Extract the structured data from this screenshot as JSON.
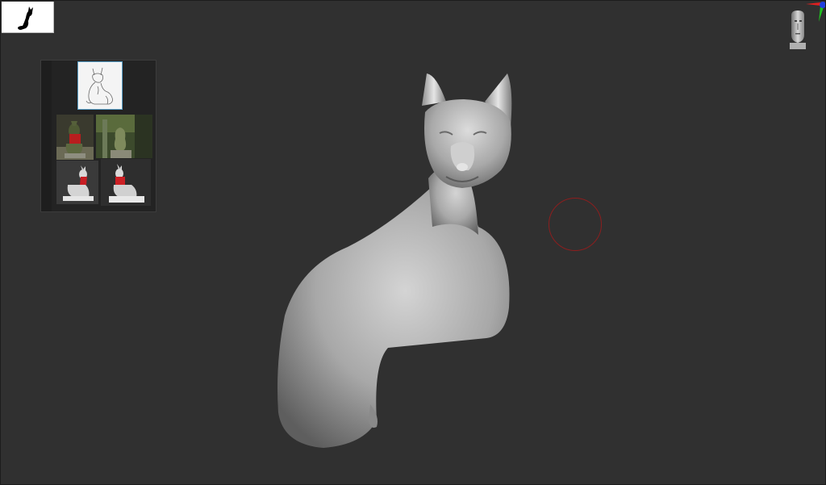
{
  "app": {
    "type": "3d-sculpting-viewport"
  },
  "silhouette_thumbnail": {
    "icon": "fox-silhouette-icon"
  },
  "reference_panel": {
    "images": [
      {
        "icon": "fox-sketch-image",
        "selected": true
      },
      {
        "icon": "fox-statue-red-bib-photo"
      },
      {
        "icon": "fox-statue-moss-photo"
      },
      {
        "icon": "white-fox-statue-photo"
      },
      {
        "icon": "white-fox-statue-side-photo"
      }
    ]
  },
  "navigation_gizmo": {
    "icon": "head-orientation-icon",
    "axes": {
      "x_color": "#e02020",
      "y_color": "#20c020",
      "z_color": "#2040e0"
    }
  },
  "brush": {
    "cursor_color": "#8c1e1e"
  },
  "model": {
    "icon": "sculpted-fox-model",
    "material_color": "#bdbdbd"
  }
}
